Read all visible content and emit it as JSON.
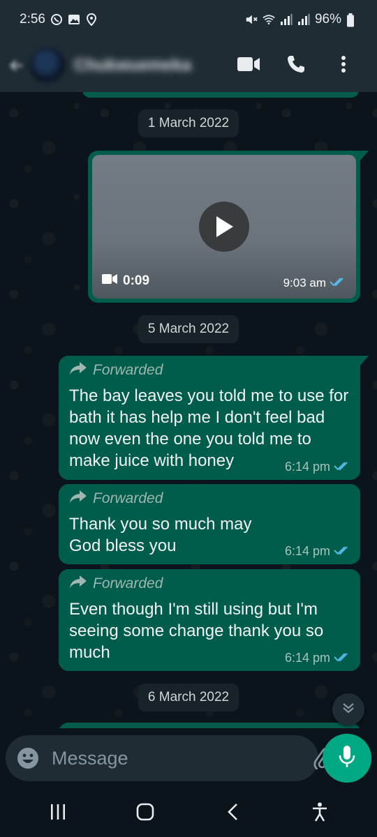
{
  "status_bar": {
    "time": "2:56",
    "battery": "96%",
    "left_icons": [
      "whatsapp-icon",
      "gallery-icon",
      "location-icon"
    ],
    "right_icons": [
      "mute-icon",
      "wifi-icon",
      "signal-icon",
      "signal-icon",
      "battery-icon"
    ]
  },
  "header": {
    "contact_name": "Chukwuemeka",
    "actions": [
      "video-call-icon",
      "phone-icon",
      "more-icon"
    ]
  },
  "chat": {
    "messages": [
      {
        "type": "date",
        "label": "1 March 2022"
      },
      {
        "type": "video",
        "duration": "0:09",
        "time": "9:03 am",
        "status": "read"
      },
      {
        "type": "date",
        "label": "5 March 2022"
      },
      {
        "type": "text",
        "forwarded_label": "Forwarded",
        "text": "The bay leaves you told me to use for bath it has help me I don't feel bad now even the one you told me to make juice with honey",
        "time": "6:14 pm",
        "status": "read"
      },
      {
        "type": "text",
        "forwarded_label": "Forwarded",
        "text": "Thank you so much may God bless you",
        "time": "6:14 pm",
        "status": "read"
      },
      {
        "type": "text",
        "forwarded_label": "Forwarded",
        "text": "Even though I'm still using but I'm seeing some change thank you so much",
        "time": "6:14 pm",
        "status": "read"
      },
      {
        "type": "date",
        "label": "6 March 2022"
      }
    ]
  },
  "composer": {
    "placeholder": "Message"
  },
  "colors": {
    "outgoing_bubble": "#005c4b",
    "app_bar": "#1f2c34",
    "accent": "#00a884",
    "read_ticks": "#53bdeb",
    "chat_background": "#0b141a"
  }
}
